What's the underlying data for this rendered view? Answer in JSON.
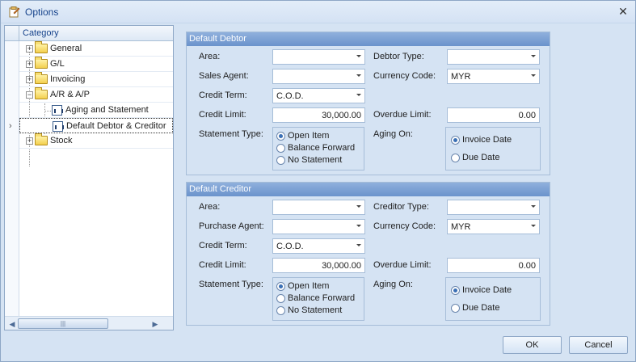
{
  "window": {
    "title": "Options"
  },
  "tree": {
    "header": "Category",
    "items": [
      {
        "label": "General"
      },
      {
        "label": "G/L"
      },
      {
        "label": "Invoicing"
      },
      {
        "label": "A/R & A/P"
      },
      {
        "label": "Aging and Statement"
      },
      {
        "label": "Default Debtor & Creditor"
      },
      {
        "label": "Stock"
      }
    ]
  },
  "debtor": {
    "title": "Default Debtor",
    "area_label": "Area:",
    "area_value": "",
    "type_label": "Debtor Type:",
    "type_value": "",
    "agent_label": "Sales Agent:",
    "agent_value": "",
    "currency_label": "Currency Code:",
    "currency_value": "MYR",
    "term_label": "Credit Term:",
    "term_value": "C.O.D.",
    "limit_label": "Credit Limit:",
    "limit_value": "30,000.00",
    "overdue_label": "Overdue Limit:",
    "overdue_value": "0.00",
    "statement_label": "Statement Type:",
    "statement_options": [
      "Open Item",
      "Balance Forward",
      "No Statement"
    ],
    "statement_selected": "Open Item",
    "aging_label": "Aging On:",
    "aging_options": [
      "Invoice Date",
      "Due Date"
    ],
    "aging_selected": "Invoice Date"
  },
  "creditor": {
    "title": "Default Creditor",
    "area_label": "Area:",
    "area_value": "",
    "type_label": "Creditor Type:",
    "type_value": "",
    "agent_label": "Purchase Agent:",
    "agent_value": "",
    "currency_label": "Currency Code:",
    "currency_value": "MYR",
    "term_label": "Credit Term:",
    "term_value": "C.O.D.",
    "limit_label": "Credit Limit:",
    "limit_value": "30,000.00",
    "overdue_label": "Overdue Limit:",
    "overdue_value": "0.00",
    "statement_label": "Statement Type:",
    "statement_options": [
      "Open Item",
      "Balance Forward",
      "No Statement"
    ],
    "statement_selected": "Open Item",
    "aging_label": "Aging On:",
    "aging_options": [
      "Invoice Date",
      "Due Date"
    ],
    "aging_selected": "Invoice Date"
  },
  "buttons": {
    "ok": "OK",
    "cancel": "Cancel"
  },
  "icons": {
    "title": "options-icon",
    "close": "close-icon",
    "folder": "folder-icon",
    "report": "report-icon"
  },
  "colors": {
    "accent": "#6b93cc",
    "background": "#d5e3f3",
    "title_text": "#15428b"
  }
}
